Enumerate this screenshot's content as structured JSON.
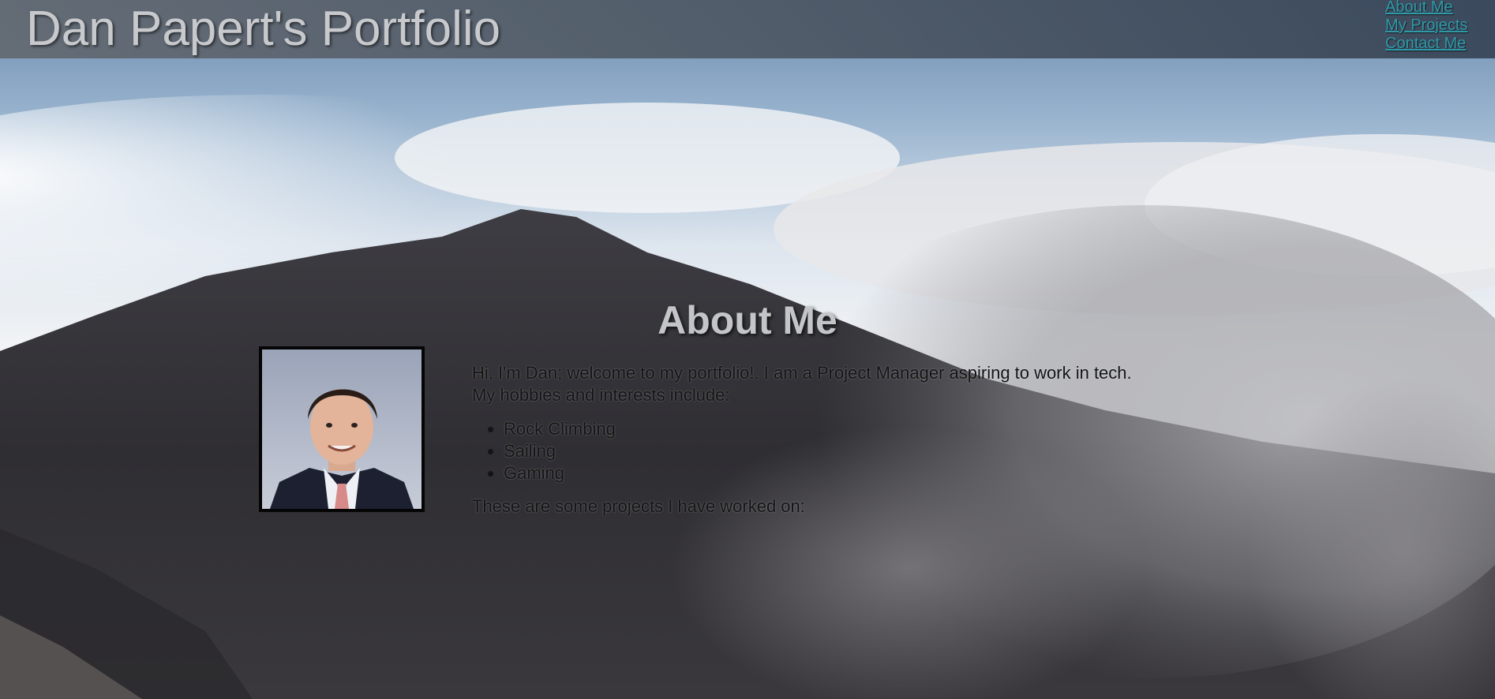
{
  "header": {
    "title": "Dan Papert's Portfolio",
    "nav": [
      {
        "label": "About Me"
      },
      {
        "label": "My Projects"
      },
      {
        "label": "Contact Me"
      }
    ]
  },
  "about": {
    "heading": "About Me",
    "intro_line1": "Hi, I'm Dan; welcome to my portfolio!. I am a Project Manager aspiring to work in tech.",
    "intro_line2": "My hobbies and interests include:",
    "hobbies": [
      "Rock Climbing",
      "Sailing",
      "Gaming"
    ],
    "projects_intro": "These are some projects I have worked on:"
  },
  "colors": {
    "nav_link": "#2f9aa8",
    "title_text": "#c7c9cc",
    "body_text": "#141414"
  }
}
